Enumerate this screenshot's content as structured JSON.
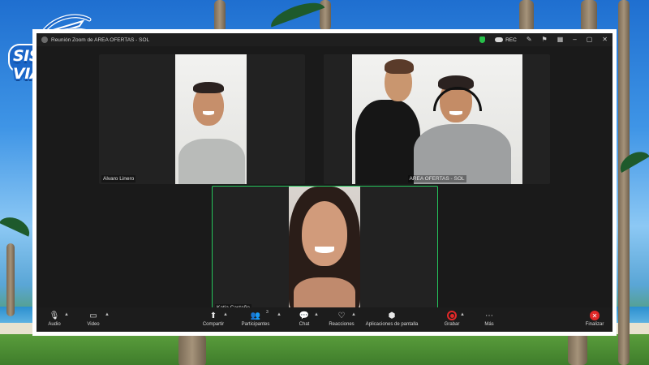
{
  "brand": {
    "logo_text": "SISTE VIAJES",
    "colors": {
      "primary": "#1a66c8",
      "frame": "#ffffff"
    }
  },
  "window": {
    "title": "Reunión Zoom de AREA OFERTAS - SOL",
    "rec_label": "REC",
    "icons": [
      "zoom-logo-icon",
      "security-shield-icon",
      "cloud-record-icon",
      "pencil-icon",
      "pin-icon",
      "grid-view-icon",
      "minimize-icon",
      "maximize-icon",
      "close-icon"
    ]
  },
  "participants": [
    {
      "name": "Alvaro Linero"
    },
    {
      "name": "AREA OFERTAS - SOL"
    },
    {
      "name": "Katia Castaño",
      "active_speaker": true
    }
  ],
  "toolbar": {
    "audio": "Audio",
    "video": "Video",
    "share": "Compartir",
    "participants": "Participantes",
    "participants_count": "3",
    "chat": "Chat",
    "reactions": "Reacciones",
    "apps": "Aplicaciones de pantalla",
    "record": "Grabar",
    "more": "Más",
    "end": "Finalizar"
  },
  "colors": {
    "active_speaker": "#25c65c",
    "end": "#e02828",
    "window_bg": "#1a1a1a"
  }
}
